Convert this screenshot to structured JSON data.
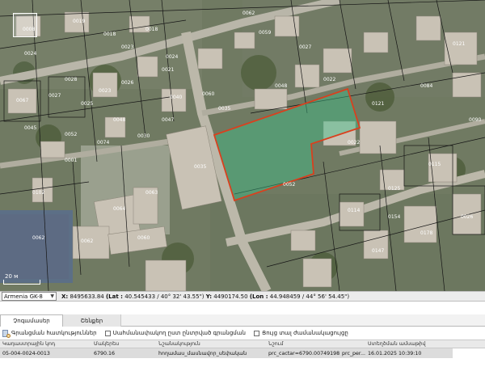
{
  "map": {
    "selected_parcel_color": "#3fbf8a",
    "selected_outline_color": "#d9401e",
    "parcel_labels": [
      "0008",
      "0019",
      "0018",
      "0018",
      "0062",
      "0024",
      "0023",
      "0024",
      "0023",
      "0028",
      "0026",
      "0021",
      "0067",
      "0027",
      "0025",
      "0048",
      "0040",
      "0047",
      "0045",
      "0052",
      "0074",
      "0030",
      "0059",
      "0027",
      "0048",
      "0022",
      "0121",
      "0035",
      "0060",
      "0035",
      "0102",
      "0063",
      "0115",
      "0125",
      "0114",
      "0154",
      "0178",
      "0147",
      "0064",
      "0062",
      "0060",
      "0062",
      "0026",
      "0001",
      "0084",
      "0121",
      "0090",
      "0052",
      "0022"
    ],
    "scale_label": "20 м",
    "icons": {
      "zoom": "zoom-box-icon"
    }
  },
  "coords": {
    "crs": "Armenia GK-8",
    "x_label": "X:",
    "x_value": "8495633.84",
    "lat_label": "(Lat :",
    "lat_value": "40.545433 / 40° 32' 43.55\")",
    "y_label": "Y:",
    "y_value": "4490174.50",
    "lon_label": "(Lon :",
    "lon_value": "44.948459 / 44° 56' 54.45\")"
  },
  "tabs": [
    {
      "label": "Չոգամասեր"
    },
    {
      "label": "Շենքեր"
    }
  ],
  "toolbar": {
    "cadastre_button": "Գրանցման հատկություններ",
    "checkbox_1": "Սահմանափակող ըստ ընտրված գրանցման",
    "checkbox_2": "Ցույց տալ ժամանակացույցը"
  },
  "table": {
    "columns": [
      "Կադաստրային կոդ",
      "Մակերես",
      "Նշանակություն",
      "Նշում",
      "",
      "Ստեղծման ամսաթիվ"
    ],
    "rows": [
      [
        "05-004-0024-0013",
        "6790.16",
        "hողամաս_մասնավոր_սեփական",
        "prc_cactar=6790.00749198",
        "prc_per...",
        "16.01.2025 10:39:10"
      ]
    ]
  }
}
